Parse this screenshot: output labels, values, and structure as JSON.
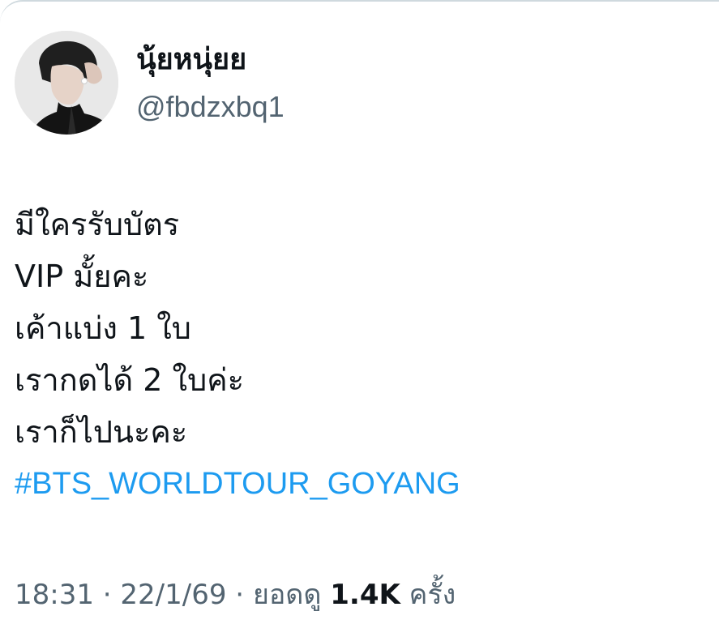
{
  "author": {
    "display_name": "นุ้ยหนุ่ยย",
    "handle": "@fbdzxbq1"
  },
  "tweet": {
    "lines": [
      "มีใครรับบัตร",
      "VIP มั้ยคะ",
      "เค้าแบ่ง 1 ใบ",
      "เรากดได้ 2 ใบค่ะ",
      "เราก็ไปนะคะ"
    ],
    "hashtag": "#BTS_WORLDTOUR_GOYANG"
  },
  "meta": {
    "time": "18:31",
    "separator": " · ",
    "date": "22/1/69",
    "views_label": "ยอดดู",
    "views_count": "1.4K",
    "views_suffix": "ครั้ง"
  },
  "colors": {
    "link": "#1d9bf0",
    "secondary_text": "#536471",
    "primary_text": "#0f1419"
  }
}
